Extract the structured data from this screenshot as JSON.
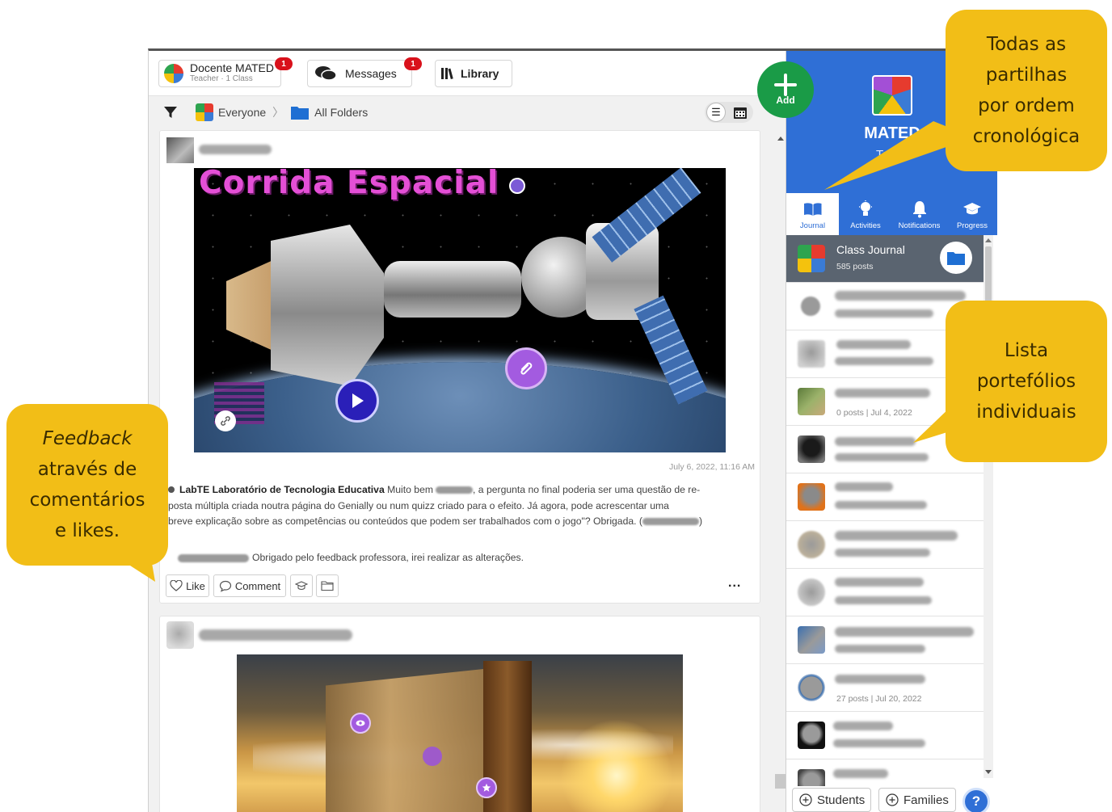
{
  "topbar": {
    "user_name": "Docente MATED",
    "user_sub": "Teacher · 1 Class",
    "user_badge": "1",
    "messages_label": "Messages",
    "messages_badge": "1",
    "library_label": "Library"
  },
  "add_button": {
    "label": "Add"
  },
  "filter": {
    "everyone": "Everyone",
    "separator": "〉",
    "folder": "All Folders"
  },
  "post1": {
    "image_title": "Corrida Espacial",
    "timestamp": "July 6, 2022, 11:16 AM",
    "comment1_author": "LabTE Laboratório de Tecnologia Educativa",
    "comment1_text_a": "Muito bem",
    "comment1_text_b": ", a pergunta no final poderia ser uma questão de re-",
    "comment1_line2": "posta múltipla criada noutra página do Genially ou num quizz criado para o efeito. Já agora, pode acrescentar uma",
    "comment1_line3a": "breve explicação sobre as competências ou conteúdos que podem ser trabalhados com o jogo\"? Obrigada. (",
    "comment1_line3b": ")",
    "comment2_text": "Obrigado pelo feedback professora, irei realizar as alterações.",
    "like_label": "Like",
    "comment_label": "Comment",
    "more": "..."
  },
  "sidebar": {
    "profile_name": "MATED",
    "profile_role": "Teach",
    "tabs": [
      {
        "label": "Journal",
        "icon": "book-icon"
      },
      {
        "label": "Activities",
        "icon": "lightbulb-icon"
      },
      {
        "label": "Notifications",
        "icon": "bell-icon"
      },
      {
        "label": "Progress",
        "icon": "graduation-cap-icon"
      }
    ],
    "class_journal": {
      "title": "Class Journal",
      "sub": "585 posts"
    },
    "rows": [
      {
        "sub": ""
      },
      {
        "sub": ""
      },
      {
        "sub": "0 posts | Jul 4, 2022"
      },
      {
        "sub": ""
      },
      {
        "sub": ""
      },
      {
        "sub": ""
      },
      {
        "sub": ""
      },
      {
        "sub": ""
      },
      {
        "sub": "27 posts | Jul 20, 2022"
      },
      {
        "sub": ""
      },
      {
        "sub": ""
      }
    ],
    "students_label": "Students",
    "families_label": "Families",
    "help": "?"
  },
  "callouts": {
    "top_right": [
      "Todas as",
      "partilhas",
      "por ordem",
      "cronológica"
    ],
    "mid_right": [
      "Lista",
      "portefólios",
      "individuais"
    ],
    "left": {
      "line1": "Feedback",
      "line2": "através de",
      "line3": "comentários",
      "line4": "e likes."
    }
  },
  "colors": {
    "sidebar_blue": "#2f6fd6",
    "callout_yellow": "#f2be17",
    "add_green": "#1a9b47",
    "badge_red": "#d9111b",
    "link_purple": "#a35be0",
    "play_blue": "#2a1fb8"
  }
}
